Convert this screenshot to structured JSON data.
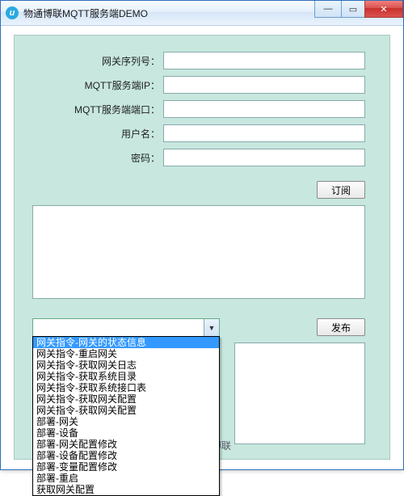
{
  "window": {
    "title": "物通博联MQTT服务端DEMO"
  },
  "form": {
    "gateway_sn_label": "网关序列号：",
    "gateway_sn_value": "",
    "server_ip_label": "MQTT服务端IP：",
    "server_ip_value": "",
    "server_port_label": "MQTT服务端端口：",
    "server_port_value": "",
    "username_label": "用户名：",
    "username_value": "",
    "password_label": "密码：",
    "password_value": ""
  },
  "buttons": {
    "subscribe": "订阅",
    "publish": "发布"
  },
  "combo": {
    "selected": "",
    "options": [
      "网关指令-网关的状态信息",
      "网关指令-重启网关",
      "网关指令-获取网关日志",
      "网关指令-获取系统目录",
      "网关指令-获取系统接口表",
      "网关指令-获取网关配置",
      "网关指令-获取网关配置",
      "部署-网关",
      "部署-设备",
      "部署-网关配置修改",
      "部署-设备配置修改",
      "部署-变量配置修改",
      "部署-重启",
      "获取网关配置"
    ]
  },
  "log_text": "",
  "publish_text": "",
  "footer_text": "厦门物通博联"
}
